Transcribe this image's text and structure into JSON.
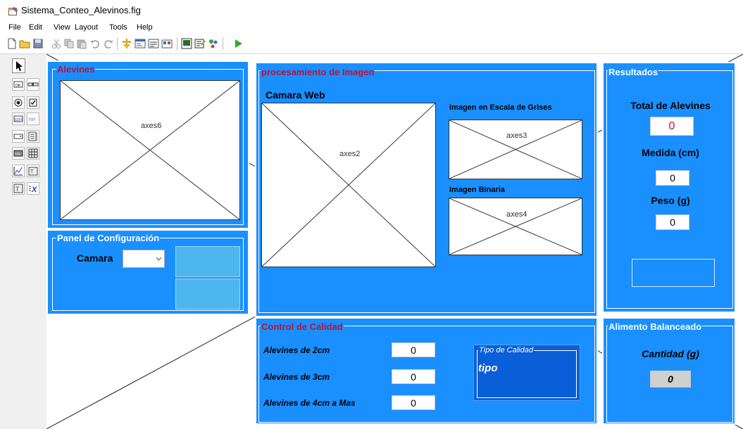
{
  "window": {
    "title": "Sistema_Conteo_Alevinos.fig"
  },
  "menu": [
    "File",
    "Edit",
    "View",
    "Layout",
    "Tools",
    "Help"
  ],
  "toolbar": {
    "icons": [
      "new-file-icon",
      "open-folder-icon",
      "save-icon",
      "cut-icon",
      "copy-icon",
      "paste-icon",
      "undo-icon",
      "redo-icon",
      "align-icon",
      "menu-editor-icon",
      "tab-order-icon",
      "toolbar-editor-icon",
      "editor-icon",
      "property-inspector-icon",
      "object-browser-icon",
      "run-icon"
    ]
  },
  "palette": {
    "icons": [
      "select-arrow-icon",
      "push-button-icon",
      "slider-icon",
      "radio-button-icon",
      "checkbox-icon",
      "edit-text-icon",
      "static-text-icon",
      "popup-menu-icon",
      "listbox-icon",
      "toggle-button-icon",
      "table-icon",
      "axes-icon",
      "panel-icon",
      "button-group-icon",
      "activex-icon"
    ]
  },
  "panels": {
    "alevines": {
      "title": "Alevines",
      "axes_label": "axes6"
    },
    "config": {
      "title": "Panel de Configuración",
      "camera_label": "Camara",
      "camera_value": ""
    },
    "procesamiento": {
      "title": "procesamiento de Imagen",
      "webcam_label": "Camara Web",
      "axes2_label": "axes2",
      "gray_label": "Imagen en Escala de Grises",
      "axes3_label": "axes3",
      "binary_label": "Imagen Binaria",
      "axes4_label": "axes4"
    },
    "resultados": {
      "title": "Resultados",
      "total_label": "Total de Alevines",
      "total_value": "0",
      "medida_label": "Medida (cm)",
      "medida_value": "0",
      "peso_label": "Peso (g)",
      "peso_value": "0"
    },
    "calidad": {
      "title": "Control de Calidad",
      "rows": [
        {
          "label": "Alevines de 2cm",
          "value": "0"
        },
        {
          "label": "Alevines de 3cm",
          "value": "0"
        },
        {
          "label": "Alevines de 4cm a Mas",
          "value": "0"
        }
      ],
      "tipo_title": "Tipo de Calidad",
      "tipo_value": "tipo"
    },
    "alimento": {
      "title": "Alimento Balanceado",
      "cantidad_label": "Cantidad (g)",
      "cantidad_value": "0"
    }
  },
  "colors": {
    "panel_bg": "#1a8fff",
    "title_red": "#c01030",
    "button_fill": "#4eb6ee",
    "tipo_bg": "#0a5fd8"
  }
}
